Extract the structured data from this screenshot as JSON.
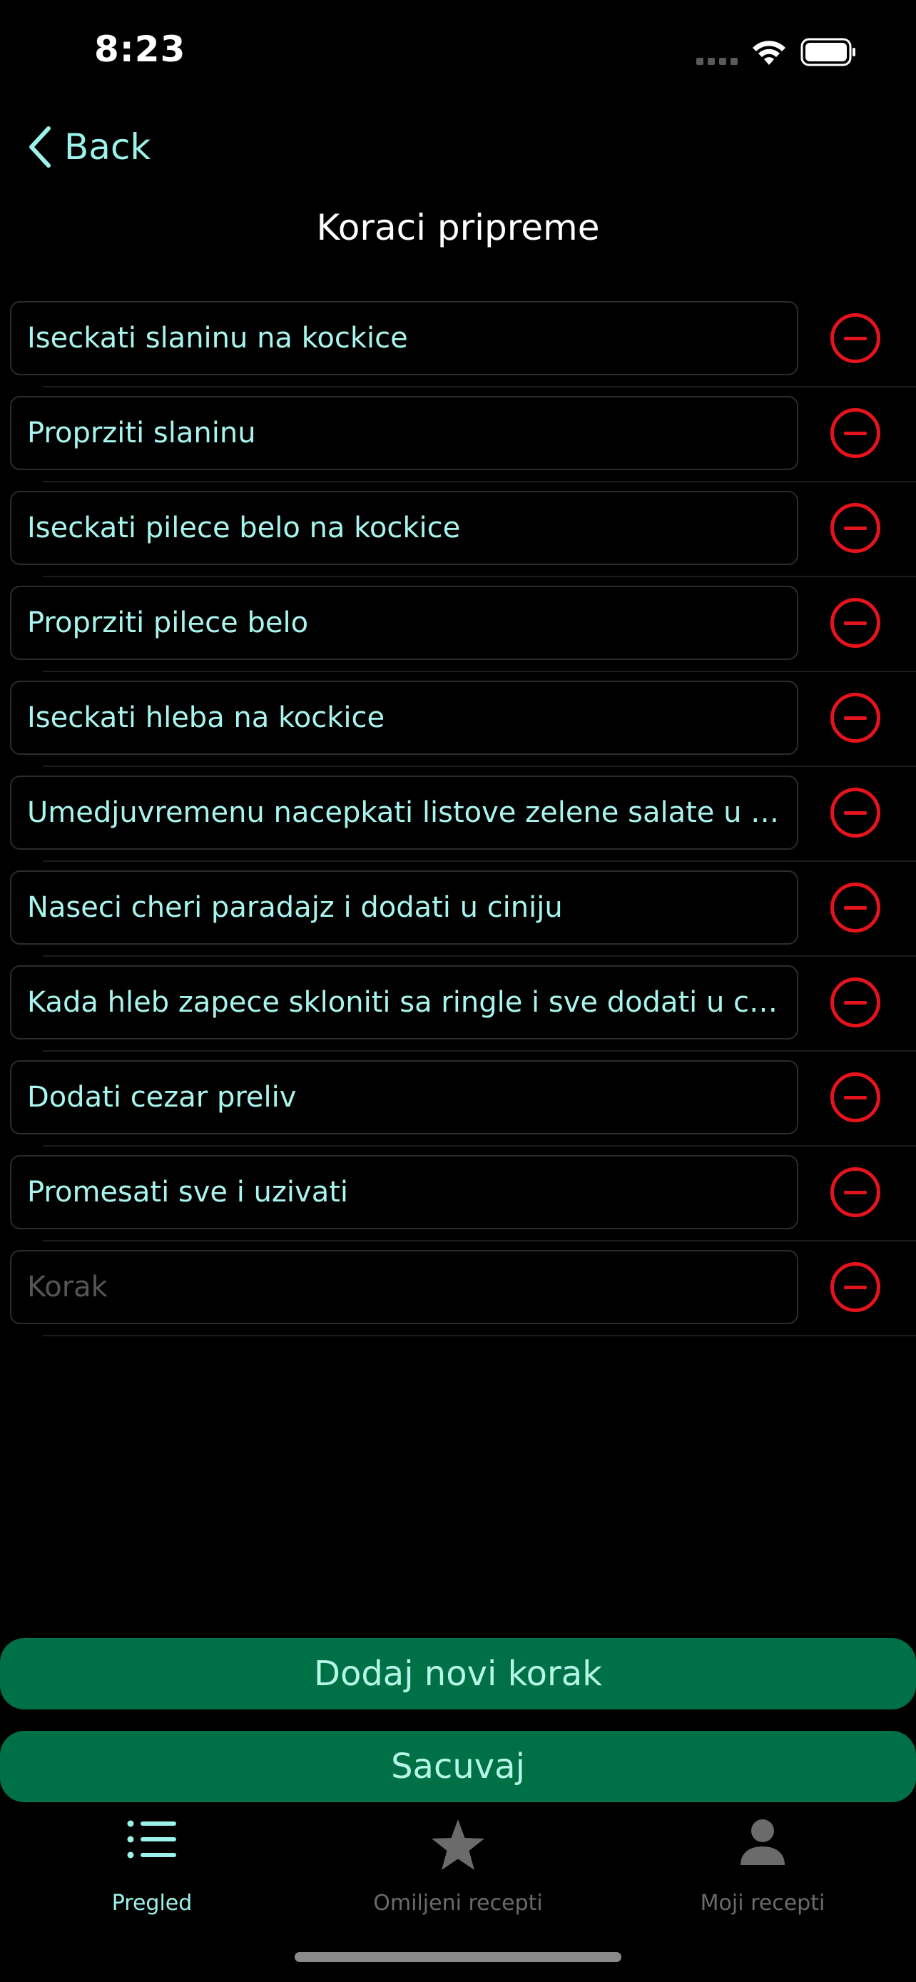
{
  "status_bar": {
    "time": "8:23"
  },
  "nav": {
    "back_label": "Back",
    "title": "Koraci pripreme"
  },
  "steps": [
    {
      "value": "Iseckati slaninu na kockice"
    },
    {
      "value": "Proprziti slaninu"
    },
    {
      "value": "Iseckati pilece belo na kockice"
    },
    {
      "value": "Proprziti pilece belo"
    },
    {
      "value": "Iseckati hleba na kockice"
    },
    {
      "value": "Umedjuvremenu nacepkati listove zelene salate u cin..."
    },
    {
      "value": "Naseci cheri paradajz i dodati u ciniju"
    },
    {
      "value": "Kada hleb zapece skloniti sa ringle i sve dodati u ciniju"
    },
    {
      "value": "Dodati cezar preliv"
    },
    {
      "value": "Promesati sve i uzivati"
    },
    {
      "value": "",
      "placeholder": "Korak"
    }
  ],
  "buttons": {
    "add_step": "Dodaj novi korak",
    "save": "Sacuvaj"
  },
  "tabbar": {
    "tabs": [
      {
        "label": "Pregled",
        "icon": "list-icon",
        "active": true
      },
      {
        "label": "Omiljeni recepti",
        "icon": "star-icon",
        "active": false
      },
      {
        "label": "Moji recepti",
        "icon": "person-icon",
        "active": false
      }
    ]
  },
  "colors": {
    "accent": "#9cf3ea",
    "button_green": "#007147",
    "remove_red": "#e5141c",
    "background": "#000000",
    "inactive_tab": "#6b6b6b"
  }
}
